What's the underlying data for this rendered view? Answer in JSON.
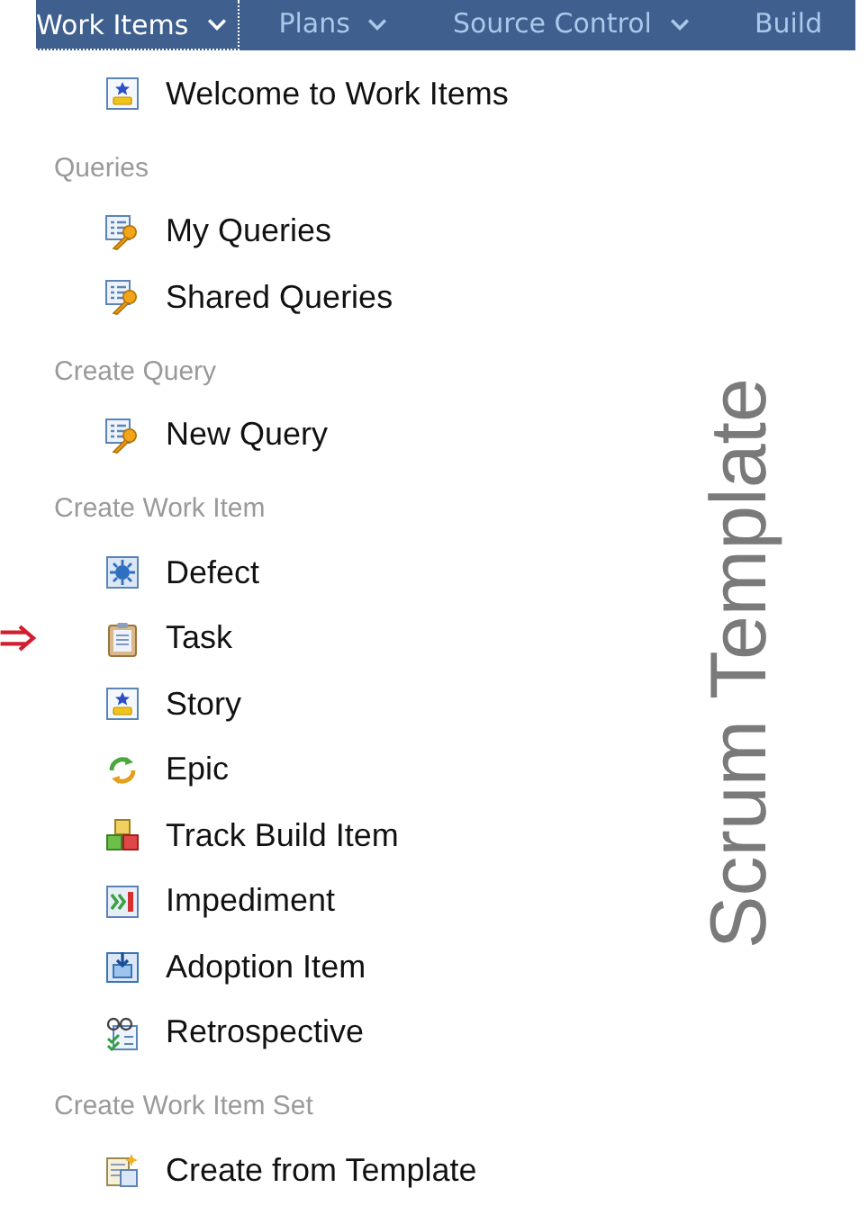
{
  "nav": [
    {
      "label": "Work Items",
      "selected": true
    },
    {
      "label": "Plans",
      "selected": false
    },
    {
      "label": "Source Control",
      "selected": false
    },
    {
      "label": "Build",
      "selected": false
    }
  ],
  "welcome": {
    "label": "Welcome to Work Items",
    "kind": "story",
    "marked": false
  },
  "sections": [
    {
      "heading": "Queries",
      "items": [
        {
          "label": "My Queries",
          "kind": "query",
          "marked": false
        },
        {
          "label": "Shared Queries",
          "kind": "query",
          "marked": false
        }
      ]
    },
    {
      "heading": "Create Query",
      "items": [
        {
          "label": "New Query",
          "kind": "query",
          "marked": false
        }
      ]
    },
    {
      "heading": "Create Work Item",
      "items": [
        {
          "label": "Defect",
          "kind": "defect",
          "marked": false
        },
        {
          "label": "Task",
          "kind": "task",
          "marked": true
        },
        {
          "label": "Story",
          "kind": "story",
          "marked": false
        },
        {
          "label": "Epic",
          "kind": "epic",
          "marked": false
        },
        {
          "label": "Track Build Item",
          "kind": "build",
          "marked": false
        },
        {
          "label": "Impediment",
          "kind": "impediment",
          "marked": false
        },
        {
          "label": "Adoption Item",
          "kind": "adoption",
          "marked": false
        },
        {
          "label": "Retrospective",
          "kind": "retrospective",
          "marked": false
        }
      ]
    },
    {
      "heading": "Create Work Item Set",
      "items": [
        {
          "label": "Create from Template",
          "kind": "template",
          "marked": false
        }
      ]
    }
  ],
  "side_title": "Scrum Template"
}
